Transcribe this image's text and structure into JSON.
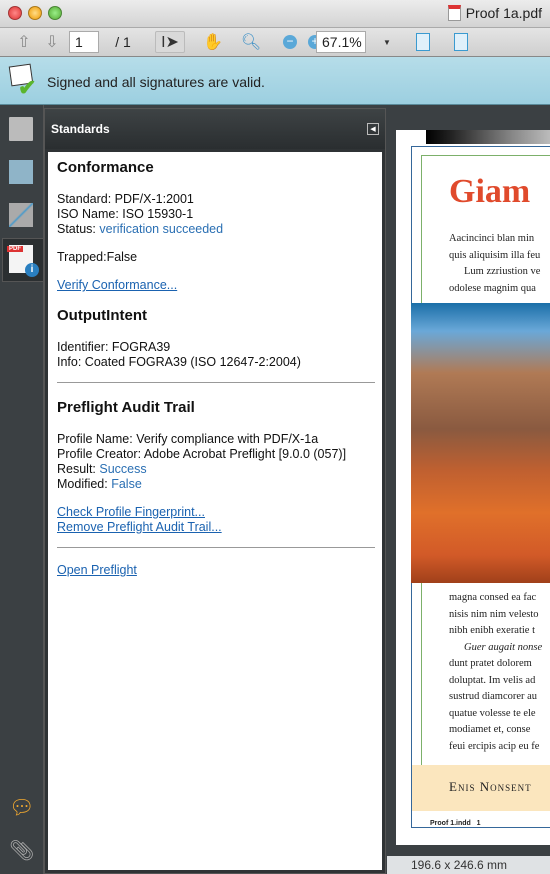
{
  "window": {
    "title": "Proof 1a.pdf"
  },
  "toolbar": {
    "page_current": "1",
    "page_total": "/  1",
    "zoom": "67.1%"
  },
  "signature_bar": {
    "message": "Signed and all signatures are valid."
  },
  "panel": {
    "title": "Standards",
    "conformance": {
      "heading": "Conformance",
      "standard": "Standard: PDF/X-1:2001",
      "iso_name": "ISO Name: ISO 15930-1",
      "status_label": "Status: ",
      "status_value": "verification succeeded",
      "trapped": "Trapped:False",
      "verify_link": "Verify Conformance..."
    },
    "output_intent": {
      "heading": "OutputIntent",
      "identifier": "Identifier: FOGRA39",
      "info": "Info: Coated FOGRA39 (ISO 12647-2:2004)"
    },
    "preflight": {
      "heading": "Preflight Audit Trail",
      "profile_name": "Profile Name: Verify compliance with PDF/X-1a",
      "profile_creator": "Profile Creator: Adobe Acrobat Preflight [9.0.0 (057)]",
      "result_label": "Result: ",
      "result_value": "Success",
      "modified_label": "Modified: ",
      "modified_value": "False",
      "check_link": "Check Profile Fingerprint...",
      "remove_link": "Remove Preflight Audit Trail...",
      "open_link": "Open Preflight"
    }
  },
  "document": {
    "headline": "Giam",
    "para1": [
      "Aacincinci blan min",
      "quis aliquisim illa feu",
      "Lum zzriustion ve",
      "odolese magnim qua"
    ],
    "para2": [
      "magna consed ea fac",
      "nisis nim nim velesto",
      "nibh enibh exeratie t",
      "Guer augait nonse",
      "dunt pratet dolorem",
      "doluptat. Im velis ad",
      "sustrud diamcorer au",
      "quatue volesse te ele",
      "modiamet et, conse",
      "feui ercipis acip eu fe"
    ],
    "footer_band": "Enis Nonsent",
    "slug": "Proof 1.indd   1"
  },
  "status_bar": {
    "page_size": "196.6 x 246.6 mm"
  },
  "colors": {
    "headline": "#e04a2c",
    "link": "#1a62b0",
    "signature_bar": "#a8d6e5"
  }
}
